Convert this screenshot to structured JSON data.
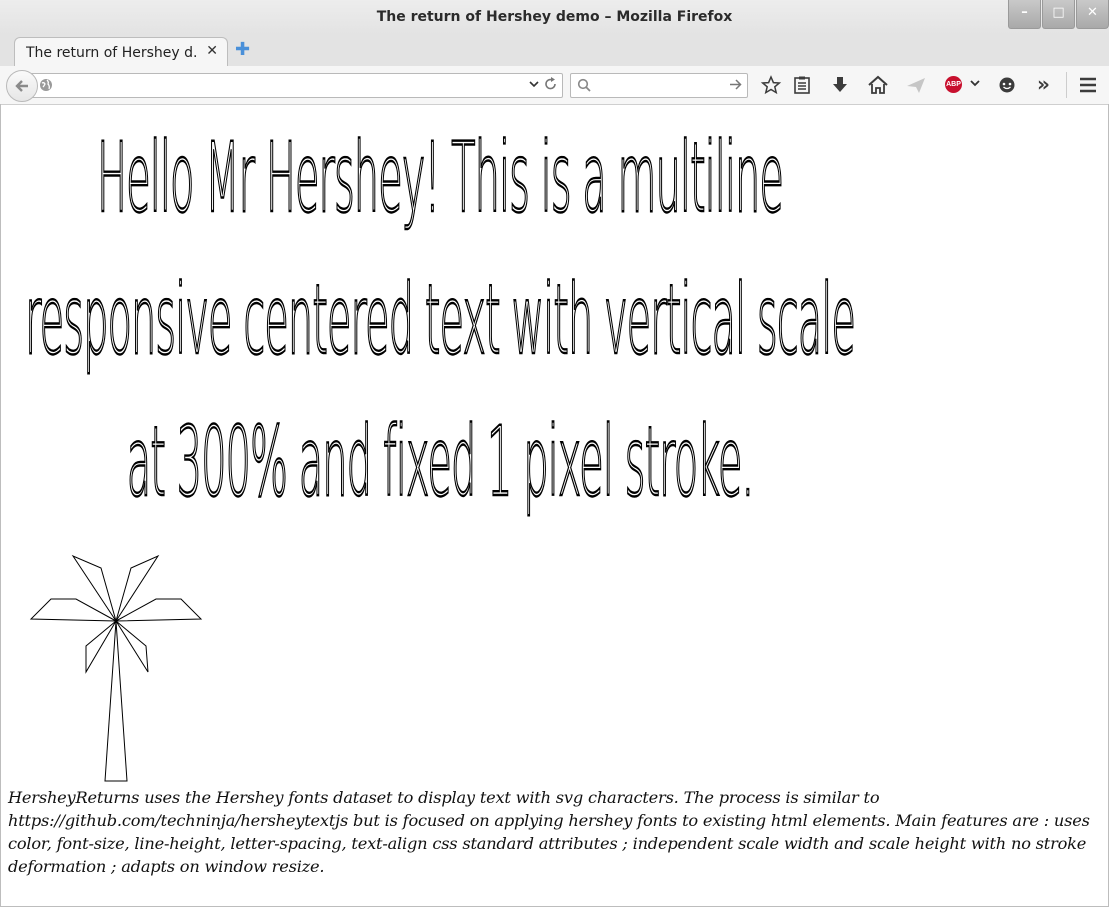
{
  "window": {
    "title": "The return of Hershey demo – Mozilla Firefox",
    "minimize_label": "–",
    "maximize_label": "□",
    "close_label": "✕"
  },
  "tabs": [
    {
      "label": "The return of Hershey d...",
      "close_label": "✕"
    }
  ],
  "new_tab_label": "✚",
  "navbar": {
    "url_value": "",
    "url_placeholder": "",
    "search_value": "",
    "search_placeholder": "",
    "icons": [
      "back-icon",
      "globe-icon",
      "dropdown-icon",
      "reload-icon",
      "search-icon",
      "go-arrow-icon",
      "bookmark-star-icon",
      "reading-list-icon",
      "download-icon",
      "home-icon",
      "send-icon",
      "adblock-plus-icon",
      "chevron-down-icon",
      "chat-icon",
      "overflow-icon",
      "menu-icon"
    ],
    "abp_text": "ABP",
    "overflow_label": "»"
  },
  "content": {
    "hershey_lines": [
      "Hello Mr Hershey! This is a multiline",
      "responsive centered text with vertical scale",
      "at 300% and fixed 1 pixel stroke."
    ],
    "palm_icon": "palm-tree-icon",
    "description": "HersheyReturns uses the Hershey fonts dataset to display text with svg characters. The process is similar to https://github.com/techninja/hersheytextjs but is focused on applying hershey fonts to existing html elements. Main features are : uses color, font-size, line-height, letter-spacing, text-align css standard attributes ; independent scale width and scale height with no stroke deformation ; adapts on window resize."
  }
}
